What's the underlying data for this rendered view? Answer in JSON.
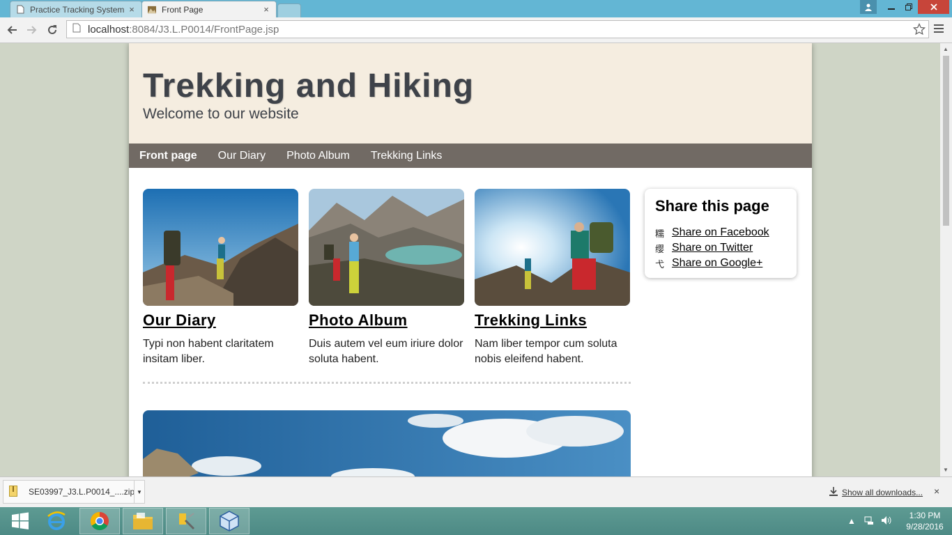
{
  "browser": {
    "tabs": [
      {
        "label": "Practice Tracking System",
        "close": "×"
      },
      {
        "label": "Front Page",
        "close": "×"
      }
    ],
    "url_host": "localhost",
    "url_rest": ":8084/J3.L.P0014/FrontPage.jsp"
  },
  "site": {
    "title": "Trekking and Hiking",
    "subtitle": "Welcome to our website",
    "nav": [
      "Front page",
      "Our Diary",
      "Photo Album",
      "Trekking Links"
    ],
    "cards": [
      {
        "title": "Our Diary",
        "desc": "Typi non habent claritatem insitam liber."
      },
      {
        "title": "Photo Album",
        "desc": "Duis autem vel eum iriure dolor soluta habent."
      },
      {
        "title": "Trekking Links",
        "desc": "Nam liber tempor cum soluta nobis eleifend habent."
      }
    ],
    "share": {
      "heading": "Share this page",
      "items": [
        {
          "icon": "facebook-glyph",
          "glyph": "糯",
          "label": "Share on Facebook"
        },
        {
          "icon": "twitter-glyph",
          "glyph": "缨",
          "label": "Share on Twitter"
        },
        {
          "icon": "googleplus-glyph",
          "glyph": "弋",
          "label": "Share on Google+"
        }
      ]
    }
  },
  "downloads": {
    "file": "SE03997_J3.L.P0014_....zip",
    "show_all": "Show all downloads...",
    "close": "×"
  },
  "taskbar": {
    "time": "1:30 PM",
    "date": "9/28/2016"
  },
  "colors": {
    "header_bg": "#f5ede0",
    "nav_bg": "#716a64",
    "title_color": "#3e4249",
    "page_bg": "#cfd5c6"
  }
}
